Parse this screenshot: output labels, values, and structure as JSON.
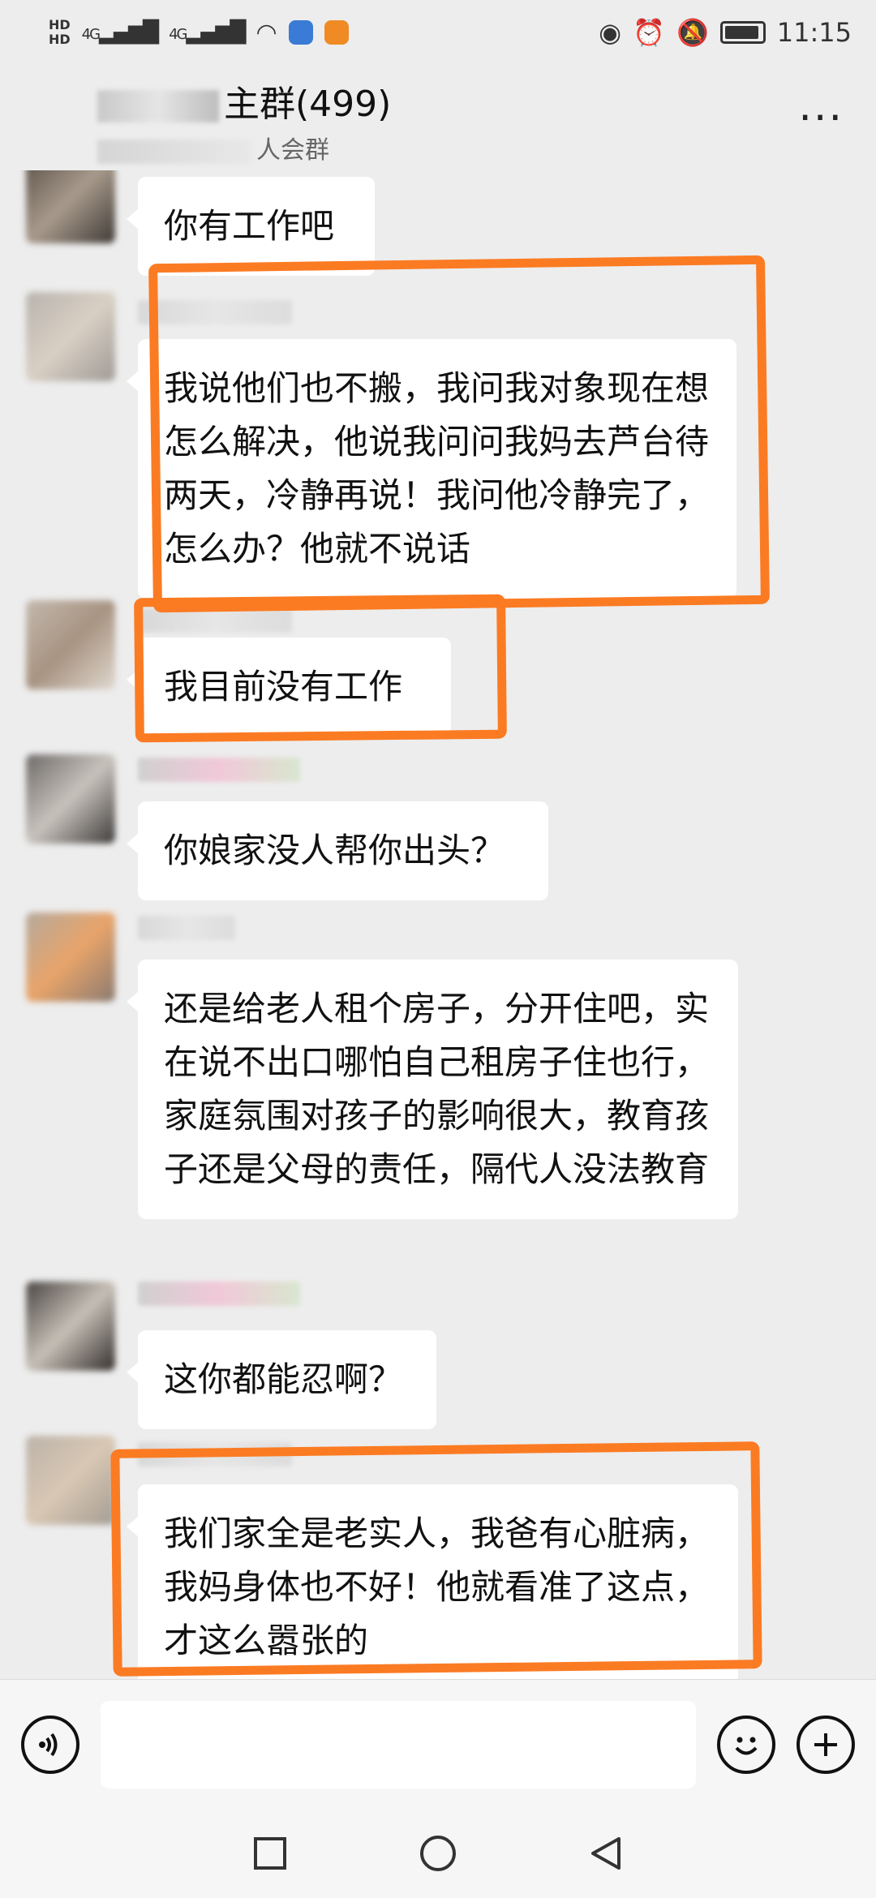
{
  "status_bar": {
    "network_left": "HD",
    "signal_1": "4G",
    "signal_2": "4G",
    "time": "11:15"
  },
  "header": {
    "title": "主群(499)",
    "subtitle": "人会群",
    "more_label": "···"
  },
  "messages": [
    {
      "text": "你有工作吧"
    },
    {
      "text": "我说他们也不搬，我问我对象现在想怎么解决，他说我问问我妈去芦台待两天，冷静再说！我问他冷静完了，怎么办？他就不说话"
    },
    {
      "text": "我目前没有工作"
    },
    {
      "text": "你娘家没人帮你出头？"
    },
    {
      "text": "还是给老人租个房子，分开住吧，实在说不出口哪怕自己租房子住也行，家庭氛围对孩子的影响很大，教育孩子还是父母的责任，隔代人没法教育"
    },
    {
      "text": "这你都能忍啊？"
    },
    {
      "text": "我们家全是老实人，我爸有心脏病，我妈身体也不好！他就看准了这点，才这么嚣张的"
    }
  ],
  "input_bar": {
    "voice_icon": "voice-icon",
    "emoji_icon": "emoji-icon",
    "plus_icon": "plus-icon"
  },
  "colors": {
    "highlight": "#fb7b23",
    "bubble": "#ffffff",
    "background": "#ededed"
  }
}
